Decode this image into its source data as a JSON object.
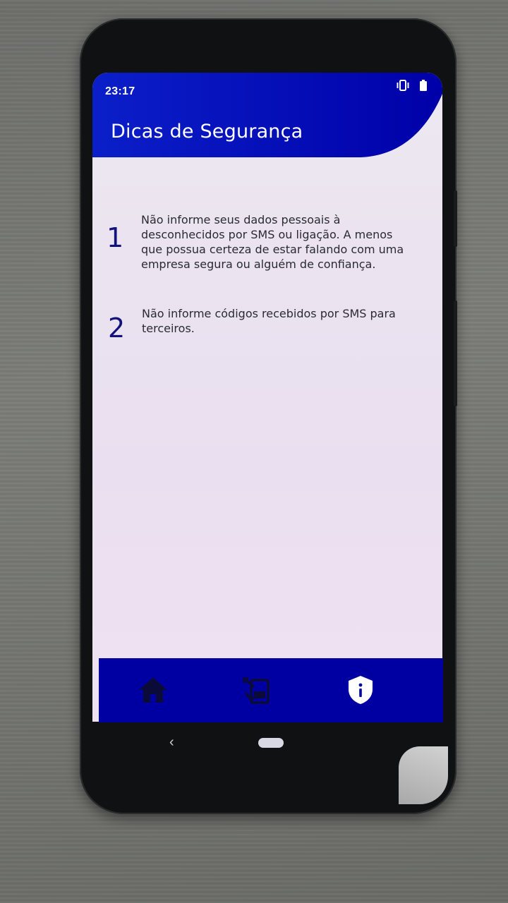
{
  "status_bar": {
    "time": "23:17",
    "icons": [
      "vibrate-icon",
      "battery-icon"
    ]
  },
  "app_bar": {
    "title": "Dicas de Segurança",
    "color": "#0000a2"
  },
  "tips": [
    {
      "number": "1",
      "lines": [
        "Não informe seus dados pessoais à",
        "desconhecidos por SMS ou ligação. A menos",
        "que possua certeza de estar falando com uma",
        "empresa segura ou alguém de confiança."
      ]
    },
    {
      "number": "2",
      "lines": [
        "Não informe códigos recebidos por SMS para",
        "terceiros."
      ]
    }
  ],
  "bottom_nav": {
    "items": [
      {
        "icon": "home-icon",
        "active": false
      },
      {
        "icon": "phone-sms-icon",
        "active": false
      },
      {
        "icon": "shield-info-icon",
        "active": true
      }
    ],
    "active_icon_color": "#ffffff",
    "inactive_icon_color": "#0b0b3a"
  },
  "system_nav": {
    "back_glyph": "‹"
  }
}
